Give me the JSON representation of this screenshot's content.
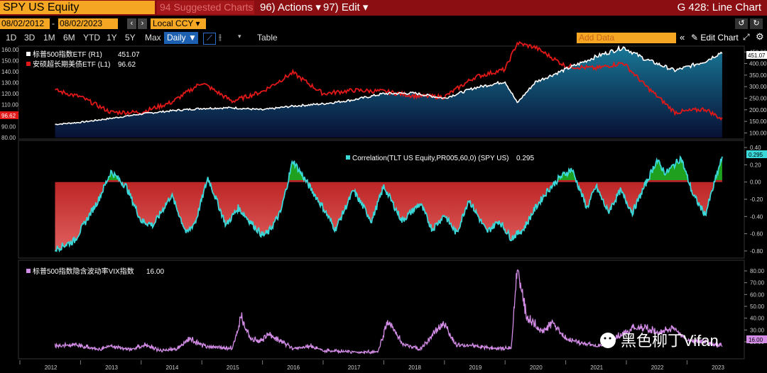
{
  "toolbar": {
    "ticker": "SPY US Equity",
    "suggested": "94 Suggested Charts",
    "actions": "96) Actions ▾",
    "edit": "97) Edit ▾",
    "title": "G 428: Line Chart"
  },
  "dates": {
    "start": "08/02/2012",
    "end": "08/02/2023",
    "currency": "Local CCY ▾"
  },
  "ranges": [
    "1D",
    "3D",
    "1M",
    "6M",
    "YTD",
    "1Y",
    "5Y",
    "Max"
  ],
  "period": "Daily ▼",
  "table_label": "Table",
  "add_data_placeholder": "Add Data",
  "edit_chart_label": "Edit Chart",
  "watermark": "黑色柳丁Vifan",
  "colors": {
    "spy": "#ffffff",
    "tlt": "#e01818",
    "corr": "#3ad8d8",
    "vix": "#d28ce6",
    "accent": "#f5a623",
    "header": "#8b0e12"
  },
  "chart_data": [
    {
      "type": "line",
      "legend": [
        "标普500指数ETF (R1)",
        "安硕超长期美债ETF (L1)"
      ],
      "legend_values": [
        "451.07",
        "96.62"
      ],
      "x": [
        2012.58,
        2013.0,
        2013.5,
        2014.0,
        2014.5,
        2015.0,
        2015.5,
        2016.0,
        2016.5,
        2017.0,
        2017.5,
        2018.0,
        2018.5,
        2019.0,
        2019.5,
        2020.0,
        2020.2,
        2020.5,
        2021.0,
        2021.5,
        2021.95,
        2022.3,
        2022.8,
        2023.0,
        2023.3,
        2023.58
      ],
      "series": [
        {
          "name": "标普500指数ETF (R1)",
          "axis": "right",
          "values": [
            137,
            146,
            163,
            182,
            196,
            206,
            209,
            200,
            216,
            226,
            243,
            270,
            272,
            250,
            295,
            322,
            230,
            320,
            375,
            430,
            470,
            420,
            370,
            385,
            410,
            451
          ]
        },
        {
          "name": "安硕超长期美债ETF (L1)",
          "axis": "left",
          "values": [
            123,
            117,
            103,
            103,
            112,
            130,
            113,
            122,
            139,
            120,
            123,
            122,
            118,
            117,
            135,
            142,
            166,
            162,
            145,
            143,
            148,
            128,
            103,
            104,
            106,
            96.62
          ]
        }
      ],
      "left_ticks": [
        "80.00",
        "90.00",
        "100.00",
        "110.00",
        "120.00",
        "130.00",
        "140.00",
        "150.00",
        "160.00"
      ],
      "left_ylim": [
        80,
        160
      ],
      "right_ticks": [
        "100.00",
        "150.00",
        "200.00",
        "250.00",
        "300.00",
        "350.00",
        "400.00",
        "450.00"
      ],
      "right_ylim": [
        80,
        460
      ],
      "right_marker": "451.07",
      "left_marker": "96.62"
    },
    {
      "type": "area",
      "legend": "Correlation(TLT US Equity,PR005,60,0) (SPY US)",
      "legend_value": "0.295",
      "x": [
        2012.58,
        2012.9,
        2013.3,
        2013.5,
        2013.75,
        2014.0,
        2014.2,
        2014.5,
        2014.75,
        2014.9,
        2015.1,
        2015.4,
        2015.6,
        2016.0,
        2016.1,
        2016.3,
        2016.5,
        2016.8,
        2017.0,
        2017.2,
        2017.5,
        2017.8,
        2018.0,
        2018.3,
        2018.6,
        2018.8,
        2019.0,
        2019.2,
        2019.4,
        2019.7,
        2019.9,
        2020.1,
        2020.3,
        2020.5,
        2020.7,
        2020.9,
        2021.1,
        2021.35,
        2021.5,
        2021.7,
        2021.9,
        2022.1,
        2022.3,
        2022.5,
        2022.65,
        2022.9,
        2023.1,
        2023.3,
        2023.58
      ],
      "values": [
        -0.78,
        -0.68,
        -0.2,
        0.12,
        -0.05,
        -0.45,
        -0.5,
        -0.15,
        -0.6,
        -0.45,
        0.05,
        -0.5,
        -0.3,
        -0.62,
        -0.58,
        -0.35,
        0.25,
        -0.08,
        -0.3,
        -0.55,
        -0.1,
        -0.45,
        -0.05,
        -0.45,
        -0.25,
        -0.55,
        -0.38,
        -0.6,
        -0.2,
        -0.58,
        -0.45,
        -0.65,
        -0.55,
        -0.3,
        -0.1,
        0.05,
        0.15,
        -0.3,
        -0.05,
        -0.35,
        -0.1,
        -0.35,
        -0.05,
        0.25,
        0.1,
        0.28,
        -0.15,
        -0.38,
        0.295
      ],
      "ticks": [
        "0.40",
        "0.20",
        "0.00",
        "-0.20",
        "-0.40",
        "-0.60",
        "-0.80"
      ],
      "ylim": [
        -0.85,
        0.45
      ],
      "marker": "0.295"
    },
    {
      "type": "line",
      "legend": "标普500指数隐含波动率VIX指数",
      "legend_value": "16.00",
      "x": [
        2012.58,
        2012.9,
        2013.3,
        2013.5,
        2013.8,
        2014.1,
        2014.3,
        2014.6,
        2014.8,
        2015.0,
        2015.5,
        2015.65,
        2015.8,
        2016.0,
        2016.1,
        2016.5,
        2016.8,
        2017.0,
        2017.5,
        2017.9,
        2018.08,
        2018.3,
        2018.6,
        2018.98,
        2019.2,
        2019.5,
        2019.8,
        2020.1,
        2020.2,
        2020.35,
        2020.6,
        2020.8,
        2021.0,
        2021.3,
        2021.6,
        2021.9,
        2022.2,
        2022.5,
        2022.8,
        2023.0,
        2023.3,
        2023.58
      ],
      "values": [
        16,
        17,
        13,
        16,
        13,
        17,
        12,
        14,
        22,
        16,
        14,
        40,
        22,
        20,
        26,
        14,
        16,
        12,
        11,
        11,
        37,
        18,
        13,
        35,
        17,
        16,
        14,
        14,
        82,
        40,
        28,
        35,
        22,
        18,
        16,
        25,
        32,
        27,
        30,
        21,
        19,
        16
      ],
      "ticks": [
        "80.00",
        "70.00",
        "60.00",
        "50.00",
        "40.00",
        "30.00",
        "20.00"
      ],
      "ylim": [
        8,
        86
      ],
      "marker": "16.00"
    }
  ],
  "x_axis_labels": [
    "2012",
    "2013",
    "2014",
    "2015",
    "2016",
    "2017",
    "2018",
    "2019",
    "2020",
    "2021",
    "2022",
    "2023"
  ]
}
